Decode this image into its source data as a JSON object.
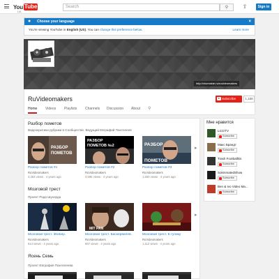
{
  "header": {
    "logo_you": "You",
    "logo_tube": "Tube",
    "logo_country": "UA",
    "search_placeholder": "Search",
    "search_icon": "search-icon",
    "upload_icon": "upload-icon",
    "signin_label": "Sign in"
  },
  "language_notice": {
    "title": "Choose your language",
    "text_before": "You're viewing YouTube in ",
    "language": "English (US)",
    "text_mid": ". You can ",
    "link": "change this preference below",
    "text_after": ".",
    "learn_more": "Learn more",
    "close": "×"
  },
  "banner": {
    "link": "http://vkontakte.ru/ruvideomakers"
  },
  "channel": {
    "title": "RuVideomakers",
    "subscribe_label": "Subscribe",
    "subscriber_count": "1,168",
    "tabs": [
      "Home",
      "Videos",
      "Playlists",
      "Channels",
      "Discussion",
      "About"
    ]
  },
  "sections": [
    {
      "title": "Разбор пометов",
      "description": "Видеокритики рубрики в Сообществе. Ведущий Евграфий Пантелеев",
      "videos": [
        {
          "title": "Разбор пометов #1",
          "channel": "RuVideomakers",
          "views": "3,363 views",
          "age": "4 years ago",
          "overlay": "РАЗБОР ПОМЕТОВ"
        },
        {
          "title": "Разбор пометов #2",
          "channel": "RuVideomakers",
          "views": "3,595 views",
          "age": "4 years ago",
          "overlay": "РАЗБОР ПОМЕТОВ №2"
        },
        {
          "title": "Разбор пометов #3",
          "channel": "RuVideomakers",
          "views": "1,550 views",
          "age": "4 years ago",
          "overlay": "РАЗБОР ПОМЕТОВ"
        }
      ]
    },
    {
      "title": "Мозговой трест",
      "description": "Проект Рода Шухорда",
      "videos": [
        {
          "title": "Мозговой трест. 3Кибер.",
          "channel": "RuVideomakers",
          "views": "914 views",
          "age": "4 years ago"
        },
        {
          "title": "Мозговой трест. Баскервилей.",
          "channel": "RuVideomakers",
          "views": "867 views",
          "age": "4 years ago"
        },
        {
          "title": "Мозговой трест. К.тупику",
          "channel": "RuVideomakers",
          "views": "1,112 views",
          "age": "4 years ago"
        }
      ]
    },
    {
      "title": "Ясень Семь",
      "description": "Проект Евграфия Пантелеева"
    }
  ],
  "sidebar": {
    "title": "Мне нравится",
    "subscribe_label": "Subscribe",
    "channels": [
      {
        "name": "LizzzTV",
        "color": "#2d5a27"
      },
      {
        "name": "Макс Брандт",
        "color": "#8a6b4a"
      },
      {
        "name": "Trash Footballkin",
        "color": "#333333"
      },
      {
        "name": "SokmmatedShow",
        "color": "#1a1a1a"
      },
      {
        "name": "Ben & Ivo Video Ma...",
        "color": "#c0392b"
      }
    ]
  },
  "colors": {
    "brand_red": "#e62117",
    "link_blue": "#167ac6"
  }
}
